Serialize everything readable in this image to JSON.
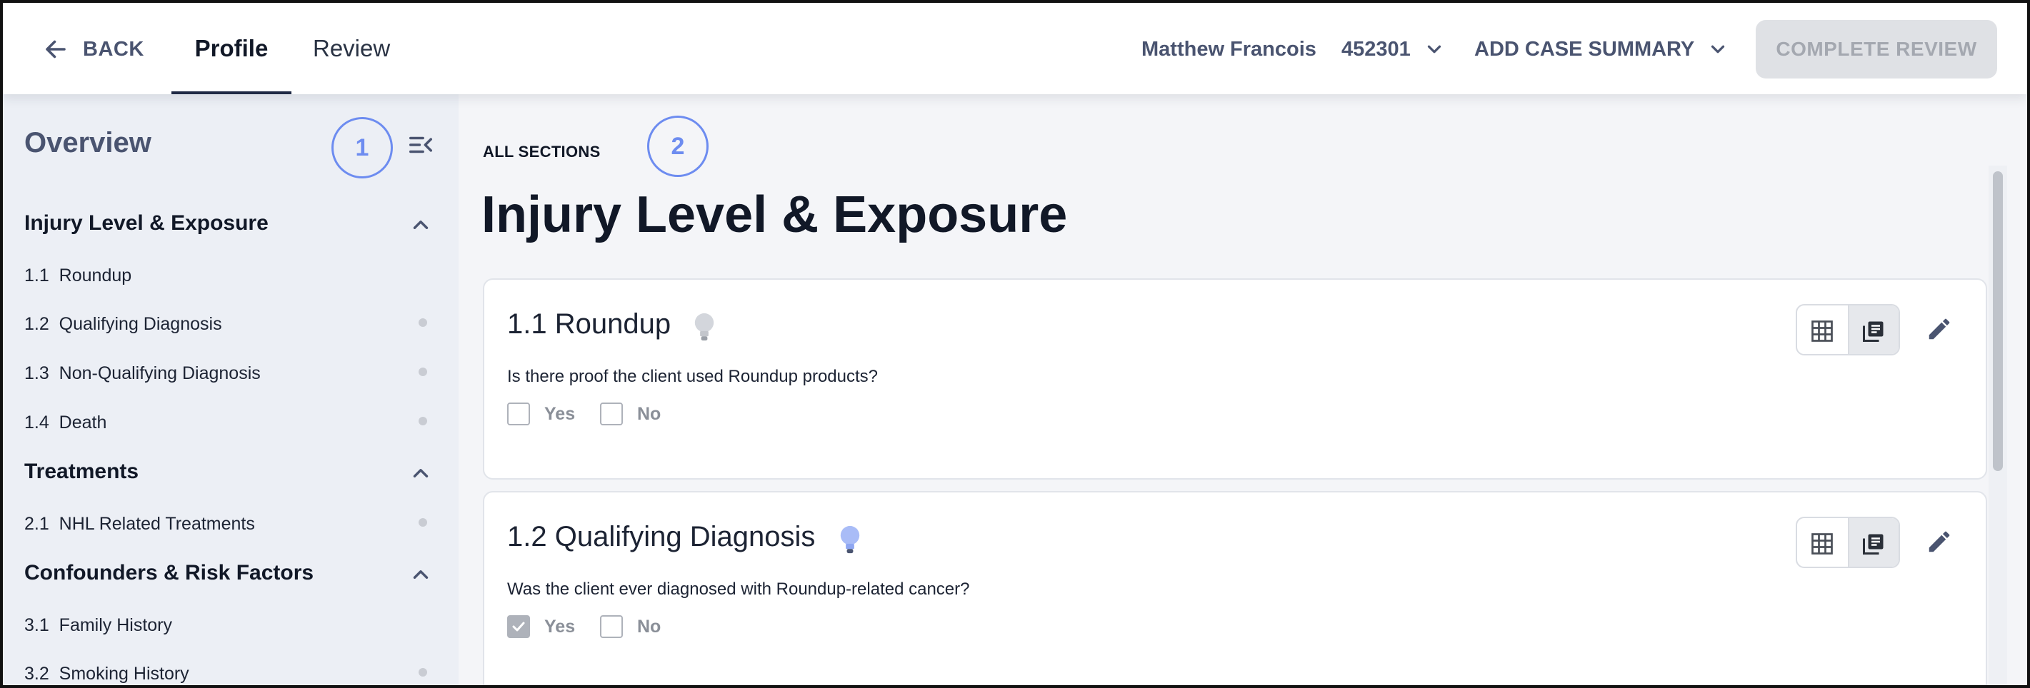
{
  "topbar": {
    "back_label": "BACK",
    "tabs": [
      {
        "label": "Profile",
        "active": true
      },
      {
        "label": "Review",
        "active": false
      }
    ],
    "user_name": "Matthew Francois",
    "case_id": "452301",
    "add_case_summary": "ADD CASE SUMMARY",
    "complete_review": "COMPLETE REVIEW"
  },
  "sidebar": {
    "title": "Overview",
    "badge": "1",
    "sections": [
      {
        "title": "Injury Level & Exposure",
        "items": [
          {
            "num": "1.1",
            "label": "Roundup",
            "dot": false
          },
          {
            "num": "1.2",
            "label": "Qualifying Diagnosis",
            "dot": true
          },
          {
            "num": "1.3",
            "label": "Non-Qualifying Diagnosis",
            "dot": true
          },
          {
            "num": "1.4",
            "label": "Death",
            "dot": true
          }
        ]
      },
      {
        "title": "Treatments",
        "items": [
          {
            "num": "2.1",
            "label": "NHL Related Treatments",
            "dot": true
          }
        ]
      },
      {
        "title": "Confounders & Risk Factors",
        "items": [
          {
            "num": "3.1",
            "label": "Family History",
            "dot": false
          },
          {
            "num": "3.2",
            "label": "Smoking History",
            "dot": true
          }
        ]
      }
    ]
  },
  "main": {
    "breadcrumb": "ALL SECTIONS",
    "badge": "2",
    "title": "Injury Level & Exposure",
    "cards": [
      {
        "title": "1.1 Roundup",
        "bulb_color": "#c9ccd3",
        "question": "Is there proof the client used Roundup products?",
        "yes_label": "Yes",
        "no_label": "No",
        "yes_checked": false,
        "no_checked": false
      },
      {
        "title": "1.2 Qualifying Diagnosis",
        "bulb_color": "#9db2f5",
        "question": "Was the client ever diagnosed with Roundup-related cancer?",
        "yes_label": "Yes",
        "no_label": "No",
        "yes_checked": true,
        "no_checked": false
      }
    ]
  },
  "colors": {
    "accent": "#6d8cf0",
    "sidebar_bg": "#eceff5",
    "main_bg": "#f4f5f8",
    "muted_text": "#4a5470"
  },
  "icons": {
    "back": "arrow-left-icon",
    "collapse_sidebar": "menu-collapse-icon",
    "section_chevron": "chevron-up-icon",
    "dropdown": "chevron-down-icon",
    "hint": "lightbulb-icon",
    "grid_view": "grid-icon",
    "list_view": "list-view-icon",
    "edit": "pencil-icon"
  }
}
